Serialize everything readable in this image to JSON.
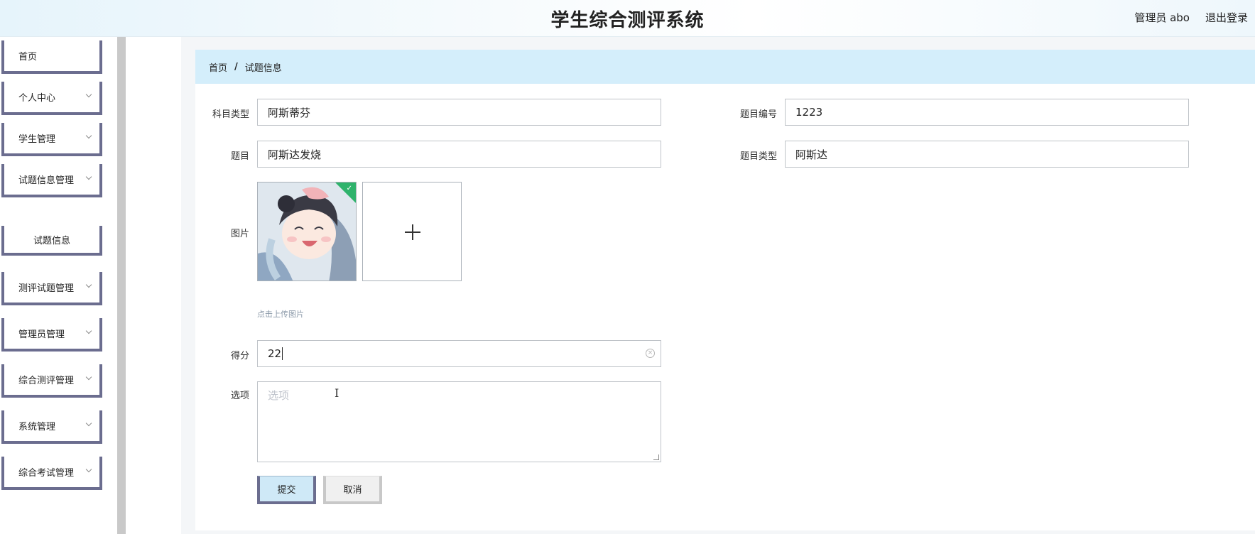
{
  "header": {
    "title": "学生综合测评系统",
    "user_label": "管理员 abo",
    "logout_label": "退出登录"
  },
  "sidebar": {
    "items": [
      {
        "label": "首页",
        "has_arrow": false
      },
      {
        "label": "个人中心",
        "has_arrow": true
      },
      {
        "label": "学生管理",
        "has_arrow": true
      },
      {
        "label": "试题信息管理",
        "has_arrow": true
      },
      {
        "label": "试题信息",
        "has_arrow": false,
        "sub": true
      },
      {
        "label": "测评试题管理",
        "has_arrow": true
      },
      {
        "label": "管理员管理",
        "has_arrow": true
      },
      {
        "label": "综合测评管理",
        "has_arrow": true
      },
      {
        "label": "系统管理",
        "has_arrow": true
      },
      {
        "label": "综合考试管理",
        "has_arrow": true
      }
    ]
  },
  "breadcrumb": {
    "home": "首页",
    "separator": "/",
    "current": "试题信息"
  },
  "form": {
    "subject_type": {
      "label": "科目类型",
      "value": "阿斯蒂芬"
    },
    "question_no": {
      "label": "题目编号",
      "value": "1223"
    },
    "question": {
      "label": "题目",
      "value": "阿斯达发烧"
    },
    "question_type": {
      "label": "题目类型",
      "value": "阿斯达"
    },
    "image": {
      "label": "图片",
      "hint": "点击上传图片"
    },
    "score": {
      "label": "得分",
      "value": "22"
    },
    "options": {
      "label": "选项",
      "placeholder": "选项"
    },
    "submit_label": "提交",
    "cancel_label": "取消"
  },
  "icons": {
    "upload": "plus-icon",
    "clear": "circle-x-icon",
    "uploaded": "check-icon",
    "menu_arrow": "chevron-down-icon"
  },
  "colors": {
    "breadcrumb_bg": "#d4eefb",
    "menu_border": "#6b6d8f",
    "submit_bg": "#cfe9f7",
    "success": "#2fb36c"
  }
}
